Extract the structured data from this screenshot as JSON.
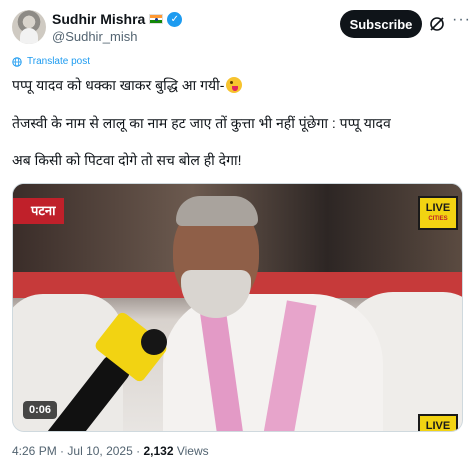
{
  "author": {
    "name": "Sudhir Mishra",
    "handle": "@Sudhir_mish",
    "flag_icon": "india-flag-icon",
    "verified_icon": "verified-badge-icon"
  },
  "actions": {
    "subscribe_label": "Subscribe",
    "grok_icon": "grok-icon",
    "more_label": "···"
  },
  "translate": {
    "label": "Translate post"
  },
  "post": {
    "line1": "पप्पू यादव को धक्का खाकर बुद्धि आ गयी-",
    "line1_emoji": "zany-face-emoji",
    "line2": "तेजस्वी के नाम से लालू का नाम हट जाए तों कुत्ता भी नहीं पूंछेगा : पप्पू यादव",
    "line3": "अब किसी को पिटवा दोगे तो सच बोल ही देगा!"
  },
  "video": {
    "location_label": "पटना",
    "live_label": "LIVE",
    "live_sub": "CITIES",
    "duration": "0:06"
  },
  "footer": {
    "time": "4:26 PM",
    "sep": "·",
    "date": "Jul 10, 2025",
    "views_count": "2,132",
    "views_label": "Views"
  },
  "colors": {
    "accent": "#1d9bf0",
    "text": "#0f1419",
    "muted": "#536471",
    "subscribe_bg": "#0f1419"
  }
}
